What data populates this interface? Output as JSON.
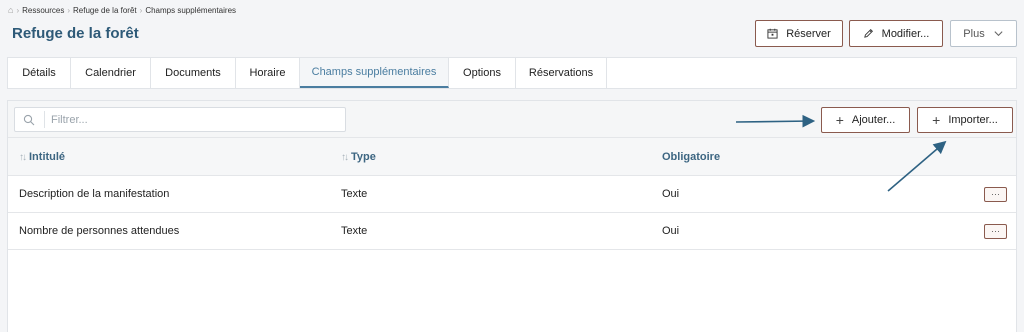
{
  "breadcrumb": {
    "home_icon": "home-icon",
    "items": [
      "Ressources",
      "Refuge de la forêt",
      "Champs supplémentaires"
    ]
  },
  "header": {
    "title": "Refuge de la forêt",
    "reserve_label": "Réserver",
    "modify_label": "Modifier...",
    "more_label": "Plus"
  },
  "tabs": [
    {
      "label": "Détails"
    },
    {
      "label": "Calendrier"
    },
    {
      "label": "Documents"
    },
    {
      "label": "Horaire"
    },
    {
      "label": "Champs supplémentaires",
      "active": true
    },
    {
      "label": "Options"
    },
    {
      "label": "Réservations"
    }
  ],
  "toolbar": {
    "search_placeholder": "Filtrer...",
    "add_label": "Ajouter...",
    "import_label": "Importer..."
  },
  "table": {
    "columns": [
      "Intitulé",
      "Type",
      "Obligatoire"
    ],
    "rows": [
      {
        "label": "Description de la manifestation",
        "type": "Texte",
        "required": "Oui",
        "action": "···"
      },
      {
        "label": "Nombre de personnes attendues",
        "type": "Texte",
        "required": "Oui",
        "action": "···"
      }
    ]
  },
  "colors": {
    "title": "#2e5a78",
    "accent_border": "#8a5a4e",
    "annotation_arrow": "#2e6283",
    "active_tab": "#4a7da0"
  }
}
